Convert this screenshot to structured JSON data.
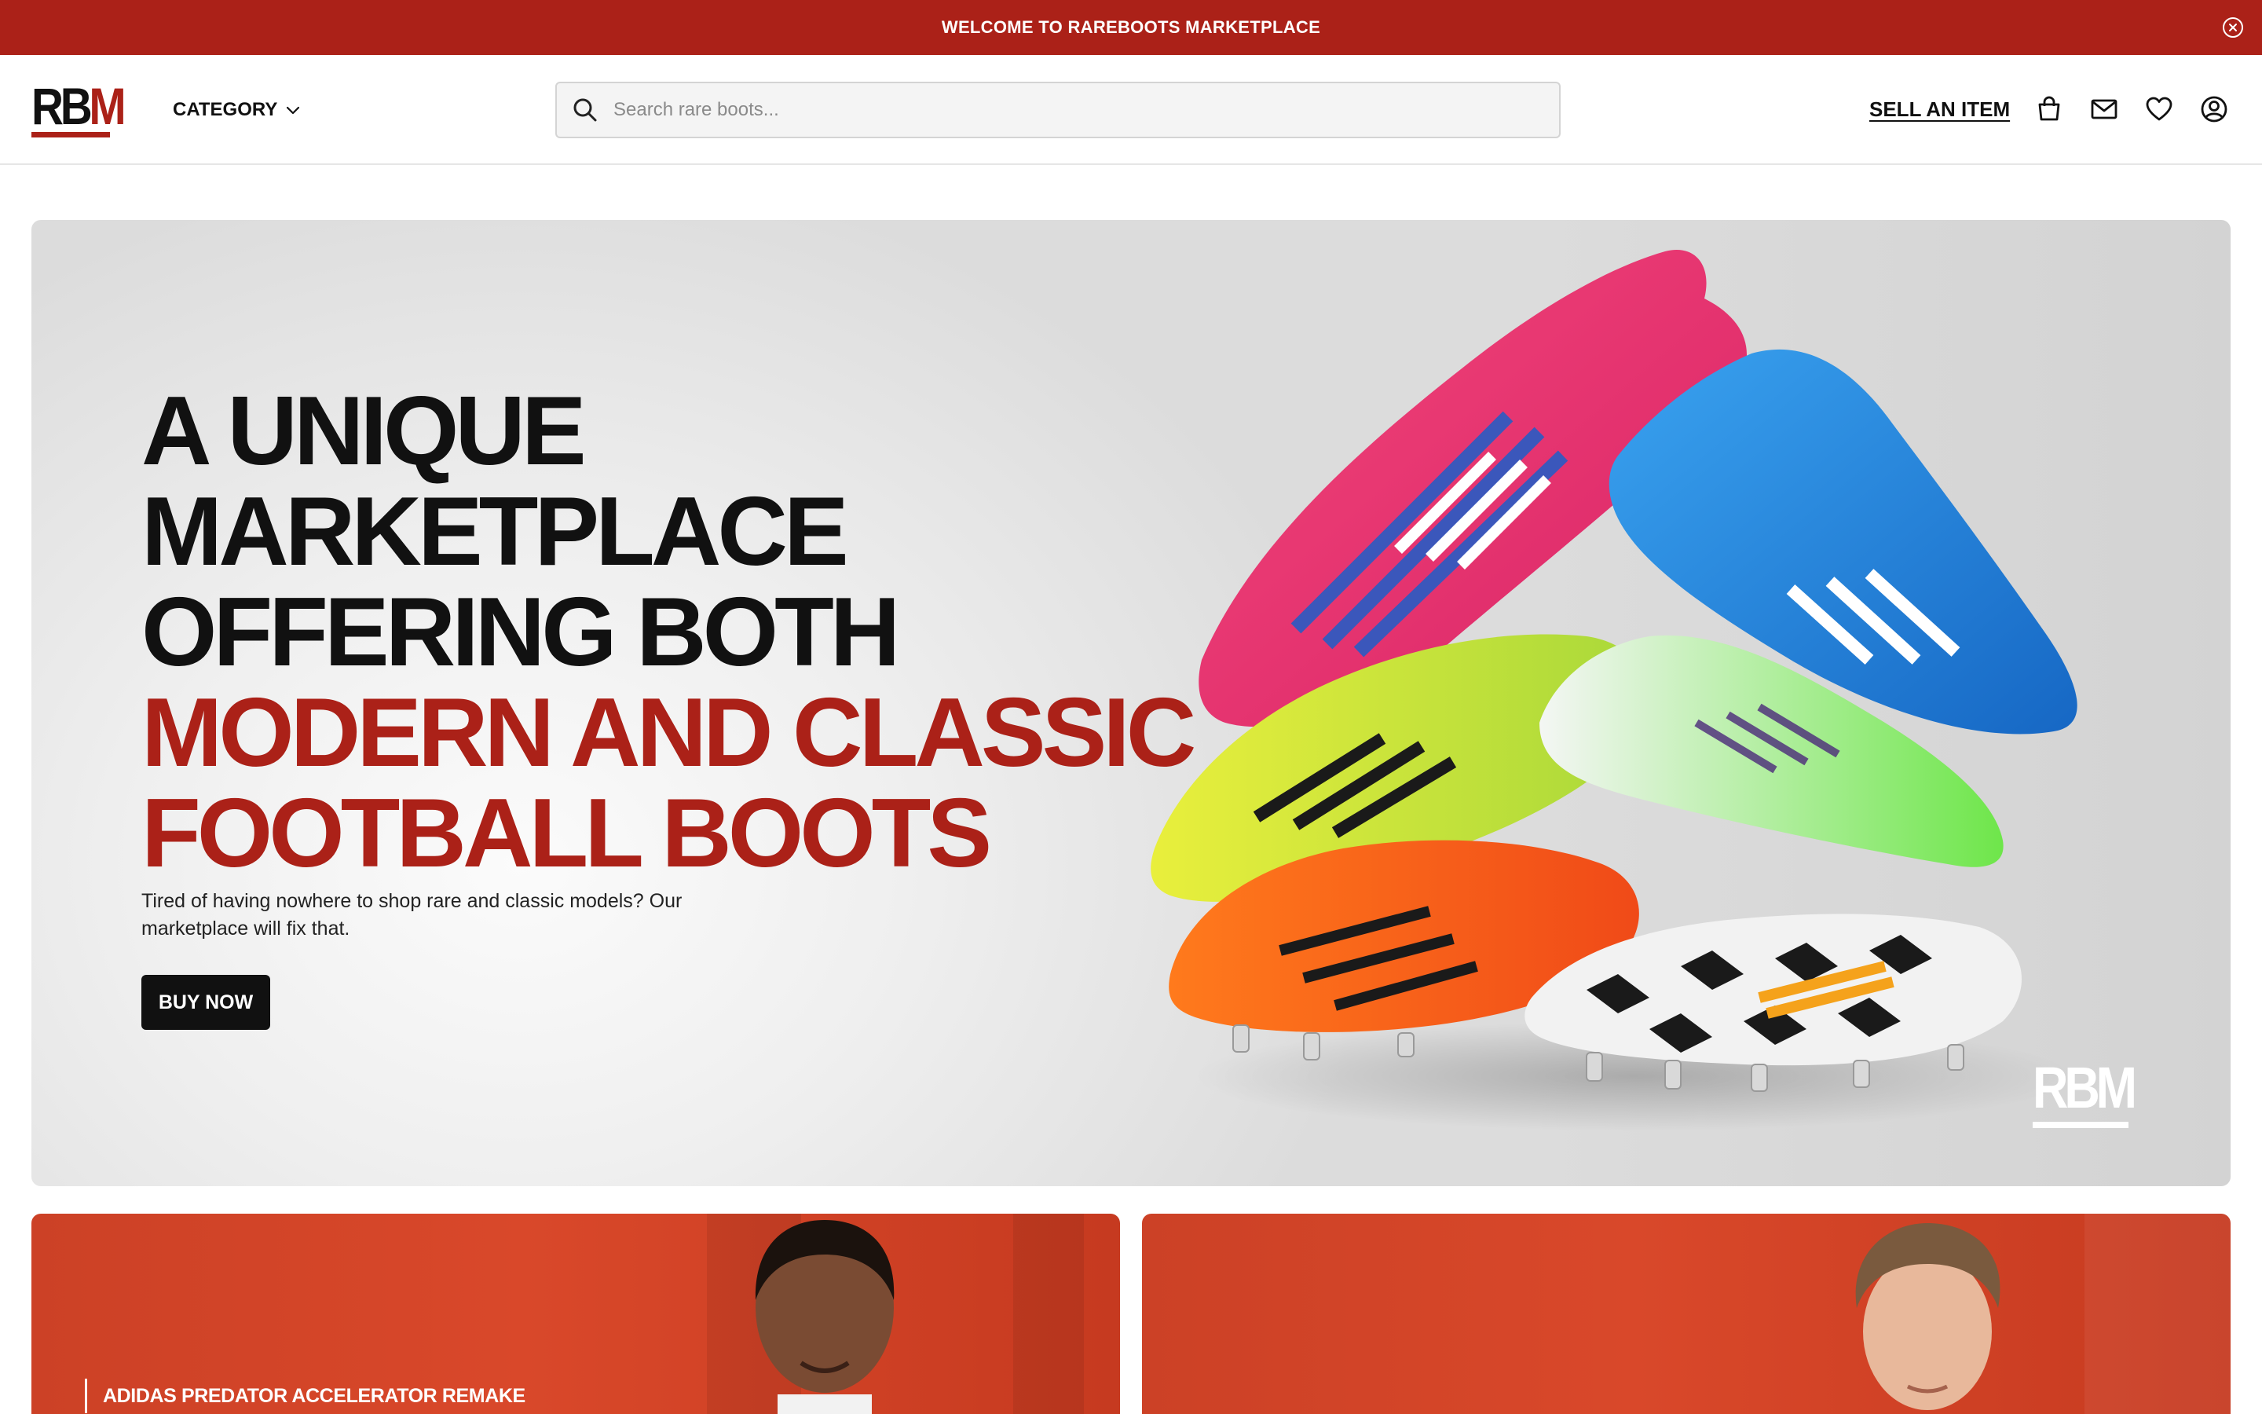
{
  "announcement": {
    "text": "WELCOME TO RAREBOOTS MARKETPLACE",
    "close_icon": "close-circle-icon"
  },
  "header": {
    "logo": {
      "r": "R",
      "b": "B",
      "m": "M"
    },
    "category_label": "CATEGORY",
    "search_placeholder": "Search rare boots...",
    "sell_label": "SELL AN ITEM",
    "icons": [
      "shopping-bag-icon",
      "mail-icon",
      "heart-icon",
      "user-account-icon"
    ]
  },
  "hero": {
    "title_lines": [
      "A UNIQUE",
      "MARKETPLACE",
      "OFFERING BOTH"
    ],
    "title_highlight_lines": [
      "MODERN AND CLASSIC",
      "FOOTBALL BOOTS"
    ],
    "subtitle": "Tired of having nowhere to shop rare and classic models? Our marketplace will fix that.",
    "cta_label": "BUY NOW",
    "watermark": "RBM"
  },
  "cards": [
    {
      "caption": "ADIDAS PREDATOR ACCELERATOR REMAKE"
    },
    {
      "caption": ""
    }
  ],
  "colors": {
    "brand_red": "#ab2118",
    "card_orange": "#d9482a",
    "text_dark": "#111111"
  }
}
